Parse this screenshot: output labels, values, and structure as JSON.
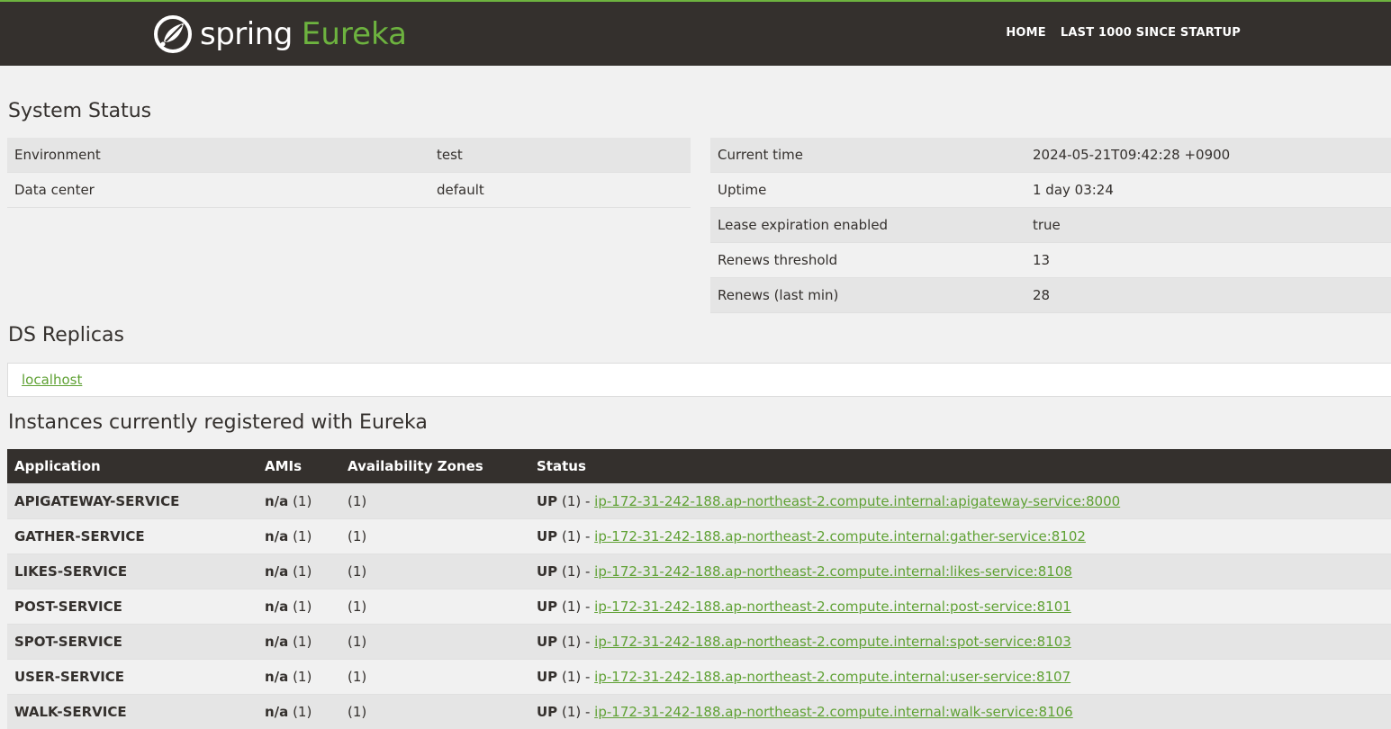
{
  "brand": {
    "spring": "spring",
    "product": "Eureka",
    "accent_color": "#6db33f",
    "navbar_color": "#34302d"
  },
  "nav": {
    "home": "HOME",
    "last1000": "LAST 1000 SINCE STARTUP"
  },
  "system_status": {
    "title": "System Status",
    "left": [
      {
        "key": "Environment",
        "value": "test"
      },
      {
        "key": "Data center",
        "value": "default"
      }
    ],
    "right": [
      {
        "key": "Current time",
        "value": "2024-05-21T09:42:28 +0900"
      },
      {
        "key": "Uptime",
        "value": "1 day 03:24"
      },
      {
        "key": "Lease expiration enabled",
        "value": "true"
      },
      {
        "key": "Renews threshold",
        "value": "13"
      },
      {
        "key": "Renews (last min)",
        "value": "28"
      }
    ]
  },
  "replicas": {
    "title": "DS Replicas",
    "items": [
      "localhost"
    ]
  },
  "instances": {
    "title": "Instances currently registered with Eureka",
    "headers": [
      "Application",
      "AMIs",
      "Availability Zones",
      "Status"
    ],
    "rows": [
      {
        "app": "APIGATEWAY-SERVICE",
        "ami": "n/a",
        "ami_count": "(1)",
        "az": "(1)",
        "status": "UP",
        "status_count": "(1) - ",
        "link": "ip-172-31-242-188.ap-northeast-2.compute.internal:apigateway-service:8000"
      },
      {
        "app": "GATHER-SERVICE",
        "ami": "n/a",
        "ami_count": "(1)",
        "az": "(1)",
        "status": "UP",
        "status_count": "(1) - ",
        "link": "ip-172-31-242-188.ap-northeast-2.compute.internal:gather-service:8102"
      },
      {
        "app": "LIKES-SERVICE",
        "ami": "n/a",
        "ami_count": "(1)",
        "az": "(1)",
        "status": "UP",
        "status_count": "(1) - ",
        "link": "ip-172-31-242-188.ap-northeast-2.compute.internal:likes-service:8108"
      },
      {
        "app": "POST-SERVICE",
        "ami": "n/a",
        "ami_count": "(1)",
        "az": "(1)",
        "status": "UP",
        "status_count": "(1) - ",
        "link": "ip-172-31-242-188.ap-northeast-2.compute.internal:post-service:8101"
      },
      {
        "app": "SPOT-SERVICE",
        "ami": "n/a",
        "ami_count": "(1)",
        "az": "(1)",
        "status": "UP",
        "status_count": "(1) - ",
        "link": "ip-172-31-242-188.ap-northeast-2.compute.internal:spot-service:8103"
      },
      {
        "app": "USER-SERVICE",
        "ami": "n/a",
        "ami_count": "(1)",
        "az": "(1)",
        "status": "UP",
        "status_count": "(1) - ",
        "link": "ip-172-31-242-188.ap-northeast-2.compute.internal:user-service:8107"
      },
      {
        "app": "WALK-SERVICE",
        "ami": "n/a",
        "ami_count": "(1)",
        "az": "(1)",
        "status": "UP",
        "status_count": "(1) - ",
        "link": "ip-172-31-242-188.ap-northeast-2.compute.internal:walk-service:8106"
      }
    ]
  }
}
